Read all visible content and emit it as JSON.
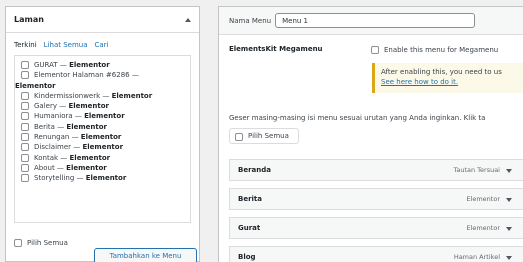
{
  "left_panel": {
    "title": "Laman",
    "tabs": [
      {
        "label": "Terkini"
      },
      {
        "label": "Lihat Semua"
      },
      {
        "label": "Cari"
      }
    ],
    "items": [
      {
        "title": "GURAT",
        "builder": "Elementor"
      },
      {
        "title": "Elementor Halaman #6286",
        "builder": "Elementor"
      },
      {
        "title": "Kindermissionwerk",
        "builder": "Elementor"
      },
      {
        "title": "Galery",
        "builder": "Elementor"
      },
      {
        "title": "Humaniora",
        "builder": "Elementor"
      },
      {
        "title": "Berita",
        "builder": "Elementor"
      },
      {
        "title": "Renungan",
        "builder": "Elementor"
      },
      {
        "title": "Disclaimer",
        "builder": "Elementor"
      },
      {
        "title": "Kontak",
        "builder": "Elementor"
      },
      {
        "title": "About",
        "builder": "Elementor"
      },
      {
        "title": "Storytelling",
        "builder": "Elementor"
      }
    ],
    "select_all_label": "Pilih Semua",
    "add_button_label": "Tambahkan ke Menu"
  },
  "right_panel": {
    "name_label": "Nama Menu",
    "name_value": "Menu 1",
    "ek_label": "ElementsKit Megamenu",
    "ek_option": "Enable this menu for Megamenu",
    "notice_text": "After enabling this, you need to us",
    "notice_link": "See here how to do it.",
    "instructions": "Geser masing-masing isi menu sesuai urutan yang Anda inginkan. Klik ta",
    "select_all_label": "Pilih Semua",
    "menu_items": [
      {
        "title": "Beranda",
        "type": "Tautan Tersuai"
      },
      {
        "title": "Berita",
        "type": "Elementor"
      },
      {
        "title": "Gurat",
        "type": "Elementor"
      },
      {
        "title": "Blog",
        "type": "Haman Artikel"
      }
    ]
  }
}
